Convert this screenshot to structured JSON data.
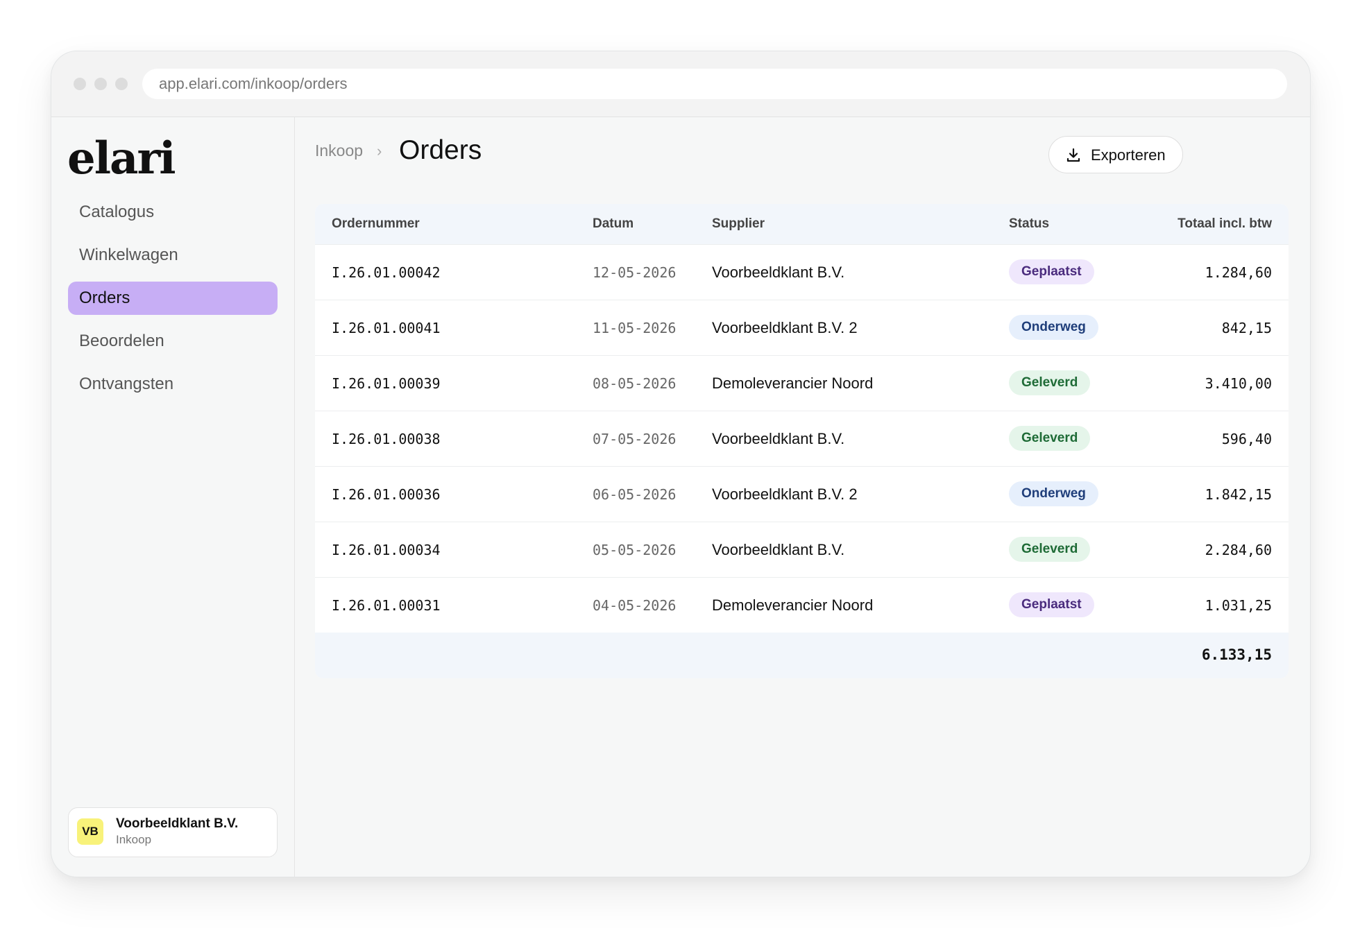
{
  "browser": {
    "url": "app.elari.com/inkoop/orders"
  },
  "sidebar": {
    "logo": "elari",
    "items": [
      {
        "label": "Catalogus",
        "active": false
      },
      {
        "label": "Winkelwagen",
        "active": false
      },
      {
        "label": "Orders",
        "active": true
      },
      {
        "label": "Beoordelen",
        "active": false
      },
      {
        "label": "Ontvangsten",
        "active": false
      }
    ],
    "profile": {
      "initials": "VB",
      "name": "Voorbeeldklant B.V.",
      "role": "Inkoop"
    }
  },
  "header": {
    "breadcrumb_parent": "Inkoop",
    "breadcrumb_separator": "›",
    "title": "Orders",
    "export_label": "Exporteren"
  },
  "table": {
    "columns": [
      "Ordernummer",
      "Datum",
      "Supplier",
      "Status",
      "Totaal incl. btw"
    ],
    "rows": [
      {
        "order": "I.26.01.00042",
        "date": "12-05-2026",
        "supplier": "Voorbeeldklant B.V.",
        "status": "Geplaatst",
        "total": "1.284,60"
      },
      {
        "order": "I.26.01.00041",
        "date": "11-05-2026",
        "supplier": "Voorbeeldklant B.V. 2",
        "status": "Onderweg",
        "total": "842,15"
      },
      {
        "order": "I.26.01.00039",
        "date": "08-05-2026",
        "supplier": "Demoleverancier Noord",
        "status": "Geleverd",
        "total": "3.410,00"
      },
      {
        "order": "I.26.01.00038",
        "date": "07-05-2026",
        "supplier": "Voorbeeldklant B.V.",
        "status": "Geleverd",
        "total": "596,40"
      },
      {
        "order": "I.26.01.00036",
        "date": "06-05-2026",
        "supplier": "Voorbeeldklant B.V. 2",
        "status": "Onderweg",
        "total": "1.842,15"
      },
      {
        "order": "I.26.01.00034",
        "date": "05-05-2026",
        "supplier": "Voorbeeldklant B.V.",
        "status": "Geleverd",
        "total": "2.284,60"
      },
      {
        "order": "I.26.01.00031",
        "date": "04-05-2026",
        "supplier": "Demoleverancier Noord",
        "status": "Geplaatst",
        "total": "1.031,25"
      }
    ],
    "footer_total": "6.133,15"
  },
  "colors": {
    "active_nav": "#c7aef5",
    "status_geplaatst": "#efe7fc",
    "status_onderweg": "#e6effc",
    "status_geleverd": "#e5f5ea",
    "avatar": "#f8f27a"
  }
}
